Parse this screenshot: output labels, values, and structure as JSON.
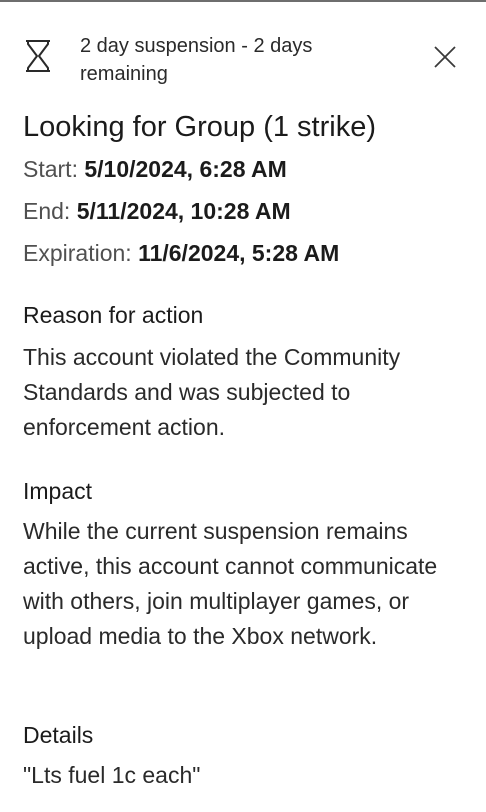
{
  "header": {
    "status_icon": "hourglass-icon",
    "status_text": "2 day suspension - 2 days remaining",
    "close_icon": "close-icon"
  },
  "enforcement": {
    "title": "Looking for Group (1 strike)",
    "start_label": "Start:",
    "start_value": "5/10/2024, 6:28 AM",
    "end_label": "End:",
    "end_value": "5/11/2024, 10:28 AM",
    "expiration_label": "Expiration:",
    "expiration_value": "11/6/2024, 5:28 AM"
  },
  "reason": {
    "heading": "Reason for action",
    "text": "This account violated the Community Standards and was subjected to enforcement action."
  },
  "impact": {
    "heading": "Impact",
    "text": "While the current suspension remains active, this account cannot communicate with others, join multiplayer games, or upload media to the Xbox network."
  },
  "details": {
    "heading": "Details",
    "text": "\"Lts fuel 1c each\""
  }
}
